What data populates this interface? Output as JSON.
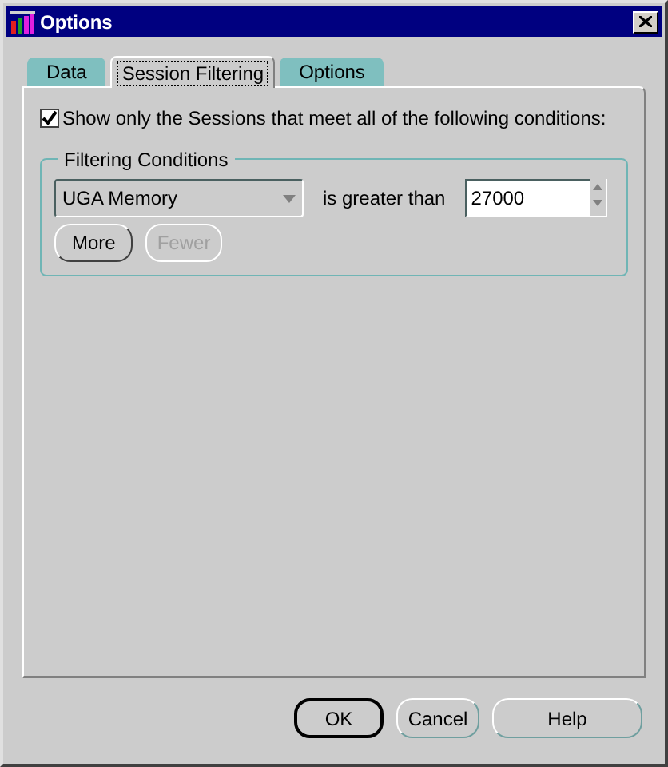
{
  "window": {
    "title": "Options"
  },
  "tabs": [
    {
      "label": "Data",
      "selected": false
    },
    {
      "label": "Session Filtering",
      "selected": true
    },
    {
      "label": "Options",
      "selected": false
    }
  ],
  "filter_checkbox": {
    "label": "Show only the Sessions that meet all of the following conditions:",
    "checked": true
  },
  "filtering_conditions": {
    "title": "Filtering Conditions",
    "attribute": {
      "value": "UGA Memory"
    },
    "operator": "is greater than",
    "threshold": {
      "value": "27000"
    },
    "buttons": [
      {
        "label": "More",
        "disabled": false
      },
      {
        "label": "Fewer",
        "disabled": true
      }
    ]
  },
  "buttons": [
    {
      "label": "OK",
      "default": true
    },
    {
      "label": "Cancel",
      "default": false
    },
    {
      "label": "Help",
      "default": false
    }
  ]
}
